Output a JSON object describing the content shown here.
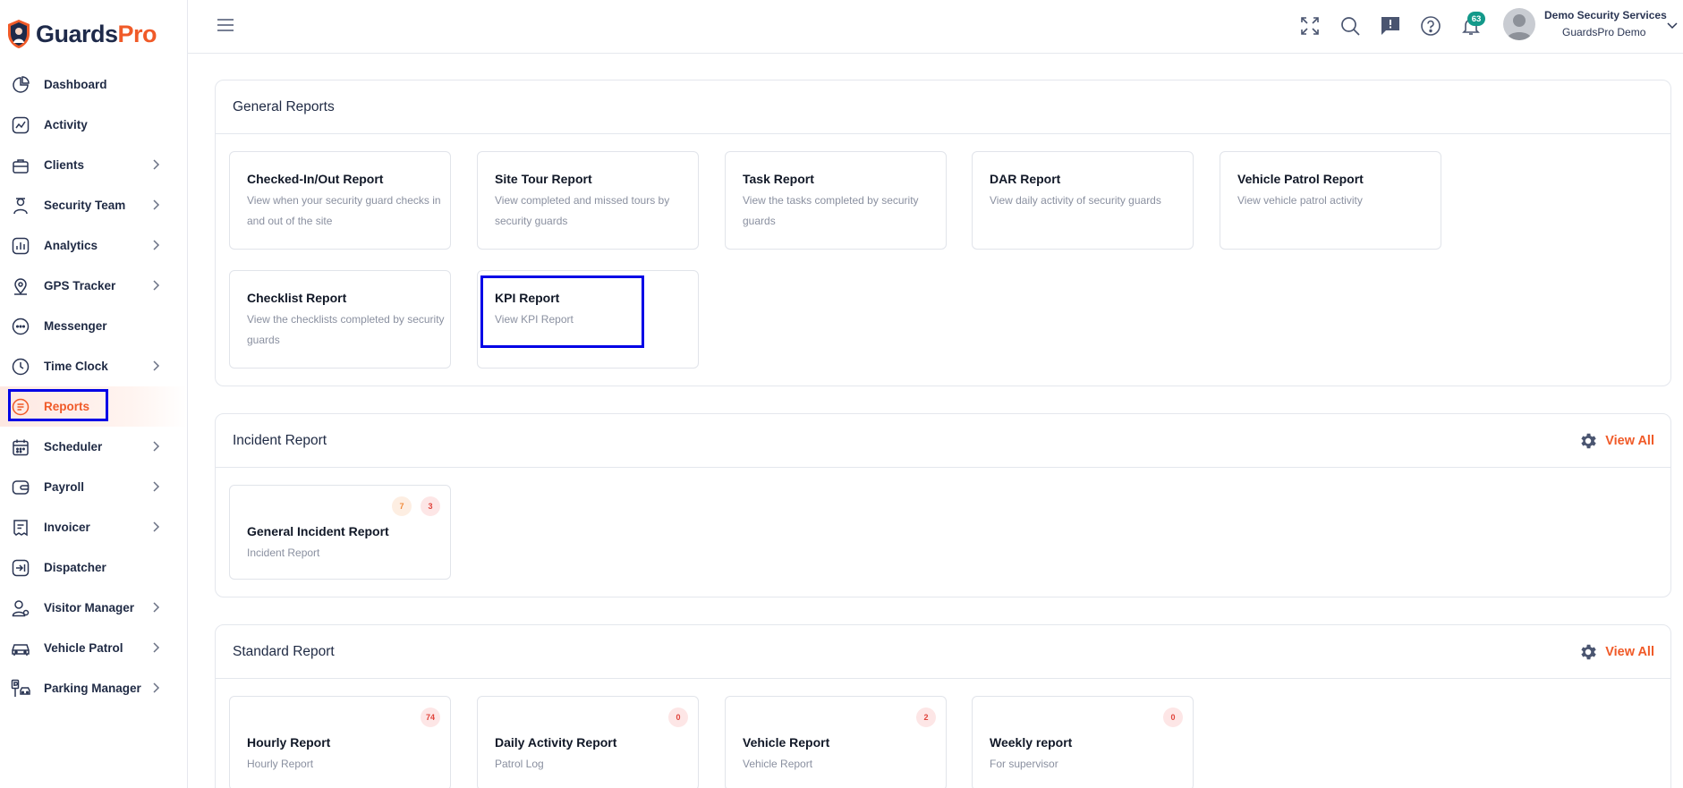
{
  "brand": {
    "part1": "Guards",
    "part2": "Pro"
  },
  "sidebar": {
    "items": [
      {
        "label": "Dashboard",
        "icon": "dashboard-icon",
        "chevron": false
      },
      {
        "label": "Activity",
        "icon": "activity-icon",
        "chevron": false
      },
      {
        "label": "Clients",
        "icon": "clients-icon",
        "chevron": true
      },
      {
        "label": "Security Team",
        "icon": "security-team-icon",
        "chevron": true
      },
      {
        "label": "Analytics",
        "icon": "analytics-icon",
        "chevron": true
      },
      {
        "label": "GPS Tracker",
        "icon": "gps-pin-icon",
        "chevron": true
      },
      {
        "label": "Messenger",
        "icon": "chat-icon",
        "chevron": false
      },
      {
        "label": "Time Clock",
        "icon": "clock-icon",
        "chevron": true
      },
      {
        "label": "Reports",
        "icon": "reports-icon",
        "chevron": false,
        "active": true
      },
      {
        "label": "Scheduler",
        "icon": "calendar-icon",
        "chevron": true
      },
      {
        "label": "Payroll",
        "icon": "wallet-icon",
        "chevron": true
      },
      {
        "label": "Invoicer",
        "icon": "invoice-icon",
        "chevron": true
      },
      {
        "label": "Dispatcher",
        "icon": "dispatch-icon",
        "chevron": false
      },
      {
        "label": "Visitor Manager",
        "icon": "visitor-icon",
        "chevron": true
      },
      {
        "label": "Vehicle Patrol",
        "icon": "car-icon",
        "chevron": true
      },
      {
        "label": "Parking Manager",
        "icon": "parking-icon",
        "chevron": true
      }
    ]
  },
  "header": {
    "notification_count": "63",
    "user_name": "Demo Security Services",
    "user_org": "GuardsPro Demo"
  },
  "general_reports": {
    "title": "General Reports",
    "cards": [
      {
        "title": "Checked-In/Out Report",
        "desc": "View when your security guard checks in and out of the site"
      },
      {
        "title": "Site Tour Report",
        "desc": "View completed and missed tours by security guards"
      },
      {
        "title": "Task Report",
        "desc": "View the tasks completed by security guards"
      },
      {
        "title": "DAR Report",
        "desc": "View daily activity of security guards"
      },
      {
        "title": "Vehicle Patrol Report",
        "desc": "View vehicle patrol activity"
      },
      {
        "title": "Checklist Report",
        "desc": "View the checklists completed by security guards"
      },
      {
        "title": "KPI Report",
        "desc": "View KPI Report"
      }
    ]
  },
  "incident_report": {
    "title": "Incident Report",
    "view_all": "View All",
    "cards": [
      {
        "title": "General Incident Report",
        "desc": "Incident Report",
        "badge_orange": "7",
        "badge_red": "3"
      }
    ]
  },
  "standard_report": {
    "title": "Standard Report",
    "view_all": "View All",
    "cards": [
      {
        "title": "Hourly Report",
        "desc": "Hourly Report",
        "badge": "74"
      },
      {
        "title": "Daily Activity Report",
        "desc": "Patrol Log",
        "badge": "0"
      },
      {
        "title": "Vehicle Report",
        "desc": "Vehicle Report",
        "badge": "2"
      },
      {
        "title": "Weekly report",
        "desc": "For supervisor",
        "badge": "0"
      }
    ]
  },
  "colors": {
    "brand_navy": "#1e2a4a",
    "brand_orange": "#f05a28",
    "highlight_box": "#0000e6",
    "badge_teal": "#13998a"
  }
}
